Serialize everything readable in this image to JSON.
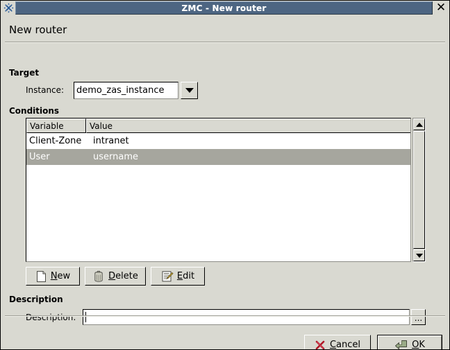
{
  "window": {
    "title": "ZMC - New router",
    "app_icon": "snowflake-icon",
    "close_label": "✕"
  },
  "heading": "New router",
  "target": {
    "group_label": "Target",
    "instance_label": "Instance:",
    "instance_value": "demo_zas_instance",
    "dropdown_icon": "chevron-down-icon"
  },
  "conditions": {
    "group_label": "Conditions",
    "columns": [
      "Variable",
      "Value"
    ],
    "rows": [
      {
        "variable": "Client-Zone",
        "value": "intranet",
        "selected": false
      },
      {
        "variable": "User",
        "value": "username",
        "selected": true
      }
    ],
    "scrollbar": {
      "up_icon": "arrow-up-icon",
      "down_icon": "arrow-down-icon"
    },
    "buttons": [
      {
        "id": "new",
        "pre": "",
        "mnemonic": "N",
        "post": "ew",
        "icon": "new-document-icon"
      },
      {
        "id": "delete",
        "pre": "",
        "mnemonic": "D",
        "post": "elete",
        "icon": "trash-can-icon"
      },
      {
        "id": "edit",
        "pre": "",
        "mnemonic": "E",
        "post": "dit",
        "icon": "edit-pencil-icon"
      }
    ]
  },
  "description": {
    "group_label": "Description",
    "field_label": "Description:",
    "value": "",
    "browse_label": "...",
    "browse_icon": "ellipsis-icon"
  },
  "footer": {
    "cancel": {
      "pre": "",
      "mnemonic": "C",
      "post": "ancel",
      "icon": "red-x-icon"
    },
    "ok": {
      "pre": "",
      "mnemonic": "O",
      "post": "K",
      "icon": "green-enter-arrow-icon"
    }
  },
  "colors": {
    "face": "#d9d9d1",
    "titlebar": "#4d6585",
    "selection": "#a6a69e",
    "field": "#ffffff",
    "cancel_icon": "#c01f2e",
    "ok_icon": "#8a9a7a"
  }
}
